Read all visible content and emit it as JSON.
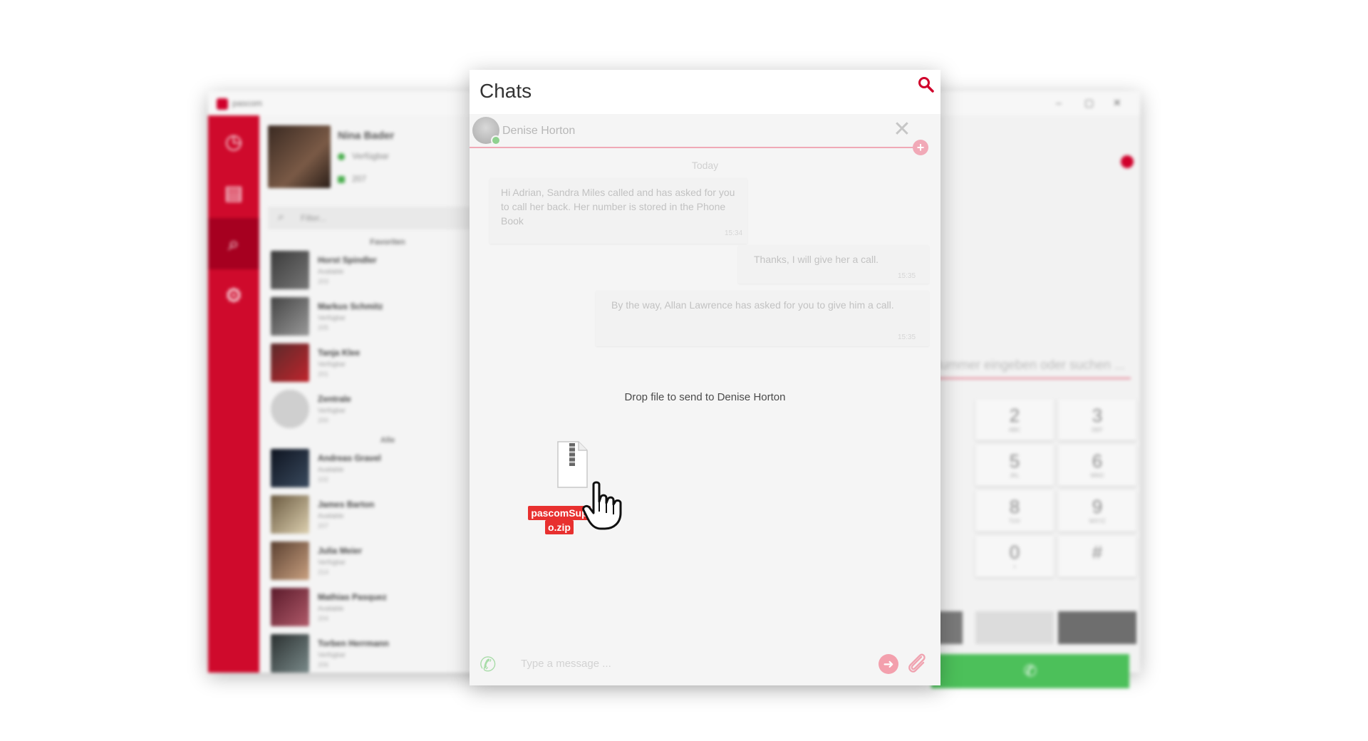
{
  "colors": {
    "accent": "#d0002b",
    "online": "#4caf50",
    "call_green": "#4cc05a",
    "light_pink": "#efa9b6"
  },
  "background_app": {
    "logo_text": "pascom",
    "me": {
      "name": "Nina Bader",
      "status": "Verfügbar",
      "extension": "207"
    },
    "filter_placeholder": "Filter...",
    "favorites_title": "Favoriten",
    "all_title": "Alle",
    "favorites": [
      {
        "name": "Horst Spindler",
        "status": "Available",
        "ext": "203"
      },
      {
        "name": "Markus Schmitz",
        "status": "Verfügbar",
        "ext": "205"
      },
      {
        "name": "Tanja Klee",
        "status": "Verfügbar",
        "ext": "201"
      },
      {
        "name": "Zentrale",
        "status": "Verfügbar",
        "ext": "200"
      }
    ],
    "all": [
      {
        "name": "Andreas Gravel",
        "status": "Available",
        "ext": "102"
      },
      {
        "name": "James Barton",
        "status": "Available",
        "ext": "207"
      },
      {
        "name": "Julia Meier",
        "status": "Verfügbar",
        "ext": "214"
      },
      {
        "name": "Mathias Pasquez",
        "status": "Available",
        "ext": "204"
      },
      {
        "name": "Torben Herrmann",
        "status": "Verfügbar",
        "ext": "206"
      }
    ],
    "dial_placeholder": "Nummer eingeben oder suchen ...",
    "dial_keys": [
      {
        "digit": "2",
        "letters": "ABC"
      },
      {
        "digit": "3",
        "letters": "DEF"
      },
      {
        "digit": "5",
        "letters": "JKL"
      },
      {
        "digit": "6",
        "letters": "MNO"
      },
      {
        "digit": "8",
        "letters": "TUV"
      },
      {
        "digit": "9",
        "letters": "WXYZ"
      },
      {
        "digit": "0",
        "letters": "+"
      },
      {
        "digit": "#",
        "letters": ""
      }
    ]
  },
  "chat": {
    "title": "Chats",
    "contact_name": "Denise Horton",
    "day_label": "Today",
    "messages": [
      {
        "text": "Hi Adrian, Sandra Miles called and has asked for you to call her back. Her number is stored in the Phone Book",
        "time": "15:34"
      },
      {
        "text": "Thanks, I will give her a call.",
        "time": "15:35"
      },
      {
        "text": "By the way, Allan Lawrence has asked for you to give him a call.",
        "time": "15:35"
      }
    ],
    "drop_text": "Drop file to send to Denise Horton",
    "drag_file_line1": "pascomSup",
    "drag_file_line2": "o.zip",
    "input_placeholder": "Type a message ..."
  }
}
